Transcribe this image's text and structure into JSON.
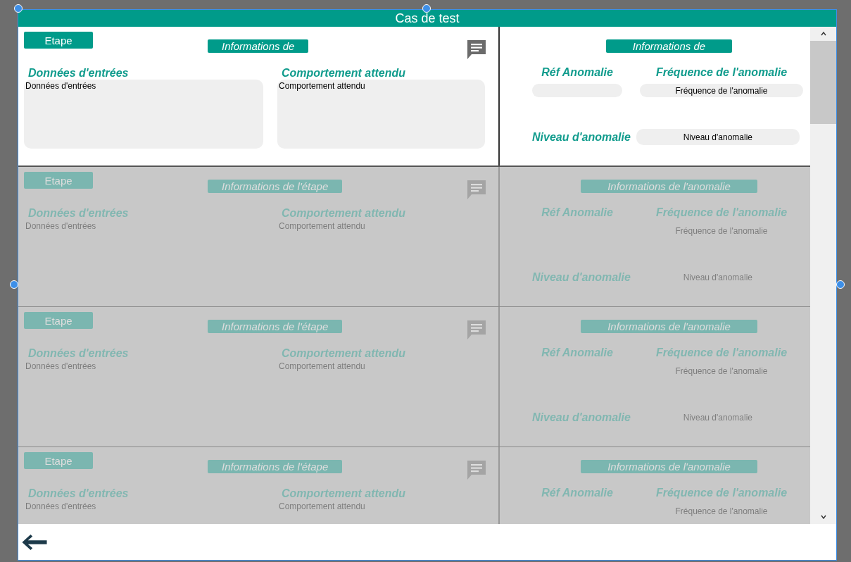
{
  "header": {
    "title": "Cas de test"
  },
  "gallery": {
    "rows": [
      {
        "selected": true,
        "step_button": "Etape",
        "step_info": "Informations de",
        "inputs_heading": "Données d'entrées",
        "inputs_value": "Données d'entrées",
        "expected_heading": "Comportement attendu",
        "expected_value": "Comportement attendu",
        "anomaly_info": "Informations de",
        "ref_heading": "Réf Anomalie",
        "frequency_heading": "Fréquence de l'anomalie",
        "frequency_value": "Fréquence de l'anomalie",
        "level_heading": "Niveau d'anomalie",
        "level_value": "Niveau d'anomalie"
      },
      {
        "selected": false,
        "step_button": "Etape",
        "step_info": "Informations de l'étape",
        "inputs_heading": "Données d'entrées",
        "inputs_value": "Données d'entrées",
        "expected_heading": "Comportement attendu",
        "expected_value": "Comportement attendu",
        "anomaly_info": "Informations de l'anomalie",
        "ref_heading": "Réf Anomalie",
        "frequency_heading": "Fréquence de l'anomalie",
        "frequency_value": "Fréquence de l'anomalie",
        "level_heading": "Niveau d'anomalie",
        "level_value": "Niveau d'anomalie"
      },
      {
        "selected": false,
        "step_button": "Etape",
        "step_info": "Informations de l'étape",
        "inputs_heading": "Données d'entrées",
        "inputs_value": "Données d'entrées",
        "expected_heading": "Comportement attendu",
        "expected_value": "Comportement attendu",
        "anomaly_info": "Informations de l'anomalie",
        "ref_heading": "Réf Anomalie",
        "frequency_heading": "Fréquence de l'anomalie",
        "frequency_value": "Fréquence de l'anomalie",
        "level_heading": "Niveau d'anomalie",
        "level_value": "Niveau d'anomalie"
      },
      {
        "selected": false,
        "step_button": "Etape",
        "step_info": "Informations de l'étape",
        "inputs_heading": "Données d'entrées",
        "inputs_value": "Données d'entrées",
        "expected_heading": "Comportement attendu",
        "expected_value": "Comportement attendu",
        "anomaly_info": "Informations de l'anomalie",
        "ref_heading": "Réf Anomalie",
        "frequency_heading": "Fréquence de l'anomalie",
        "frequency_value": "Fréquence de l'anomalie"
      }
    ]
  },
  "footer": {
    "back_button": true
  }
}
